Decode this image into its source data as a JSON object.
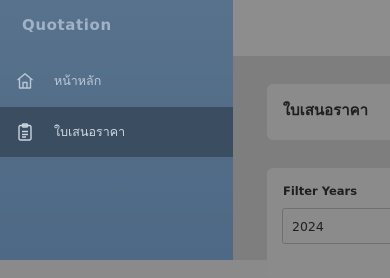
{
  "sidebar": {
    "app_title": "Quotation",
    "items": [
      {
        "label": "หน้าหลัก",
        "icon": "home-icon",
        "active": false
      },
      {
        "label": "ใบเสนอราคา",
        "icon": "clipboard-icon",
        "active": true
      }
    ]
  },
  "main": {
    "page_title": "ใบเสนอราคา",
    "filter": {
      "label": "Filter Years",
      "value": "2024"
    }
  },
  "colors": {
    "sidebar": "#58728d",
    "sidebar_active": "#3b4d60",
    "overlay_content": "#7e7e7e"
  }
}
